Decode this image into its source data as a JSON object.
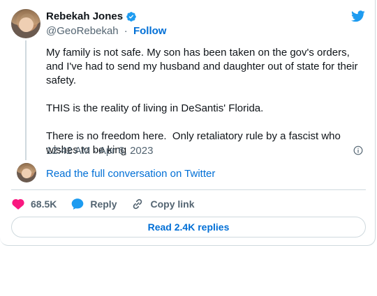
{
  "author": {
    "name": "Rebekah Jones",
    "handle": "@GeoRebekah",
    "separator": "·",
    "follow_label": "Follow"
  },
  "tweet": {
    "text": "My family is not safe. My son has been taken on the gov's orders, and I've had to send my husband and daughter out of state for their safety.\n\nTHIS is the reality of living in DeSantis' Florida.\n\nThere is no freedom here.  Only retaliatory rule by a fascist who wishes to be king",
    "timestamp": "12:42 AM · Apr 6, 2023"
  },
  "conversation_link": "Read the full conversation on Twitter",
  "actions": {
    "like_count": "68.5K",
    "reply_label": "Reply",
    "copy_label": "Copy link"
  },
  "read_replies_label": "Read 2.4K replies",
  "colors": {
    "link": "#006fd6",
    "secondary": "#536471",
    "like": "#f91880",
    "twitter_blue": "#1d9bf0",
    "border": "#cfd9de"
  },
  "icons": [
    "verified-badge-icon",
    "twitter-bird-icon",
    "info-icon",
    "heart-icon",
    "reply-bubble-icon",
    "link-icon"
  ]
}
